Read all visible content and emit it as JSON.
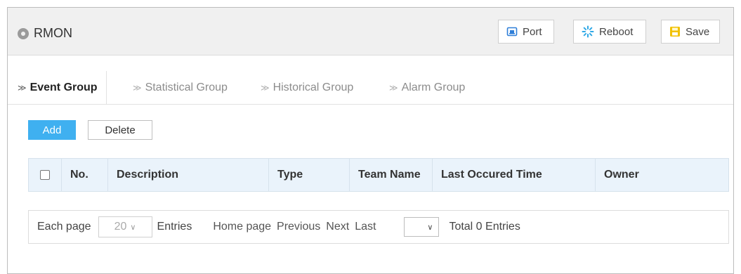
{
  "header": {
    "title": "RMON",
    "buttons": {
      "port": "Port",
      "reboot": "Reboot",
      "save": "Save"
    }
  },
  "tabs": [
    {
      "label": "Event Group",
      "active": true
    },
    {
      "label": "Statistical Group",
      "active": false
    },
    {
      "label": "Historical Group",
      "active": false
    },
    {
      "label": "Alarm Group",
      "active": false
    }
  ],
  "actions": {
    "add": "Add",
    "delete": "Delete"
  },
  "table": {
    "columns": [
      "No.",
      "Description",
      "Type",
      "Team Name",
      "Last Occured Time",
      "Owner"
    ],
    "rows": []
  },
  "pagination": {
    "each_page": "Each page",
    "page_size": "20",
    "entries": "Entries",
    "home": "Home page",
    "previous": "Previous",
    "next": "Next",
    "last": "Last",
    "jump_value": "",
    "total": "Total 0 Entries"
  },
  "colors": {
    "accent": "#3fb0f0",
    "header_bg": "#f0f0f0",
    "table_header_bg": "#eaf3fb",
    "port_icon": "#2f7fd8",
    "reboot_icon": "#2fa8e6",
    "save_icon": "#f2c200"
  },
  "icons": {
    "title": "status-dot-icon",
    "port": "port-icon",
    "reboot": "reboot-icon",
    "save": "save-icon",
    "tab": "chevron-right-icon",
    "dropdown": "chevron-down-icon"
  }
}
